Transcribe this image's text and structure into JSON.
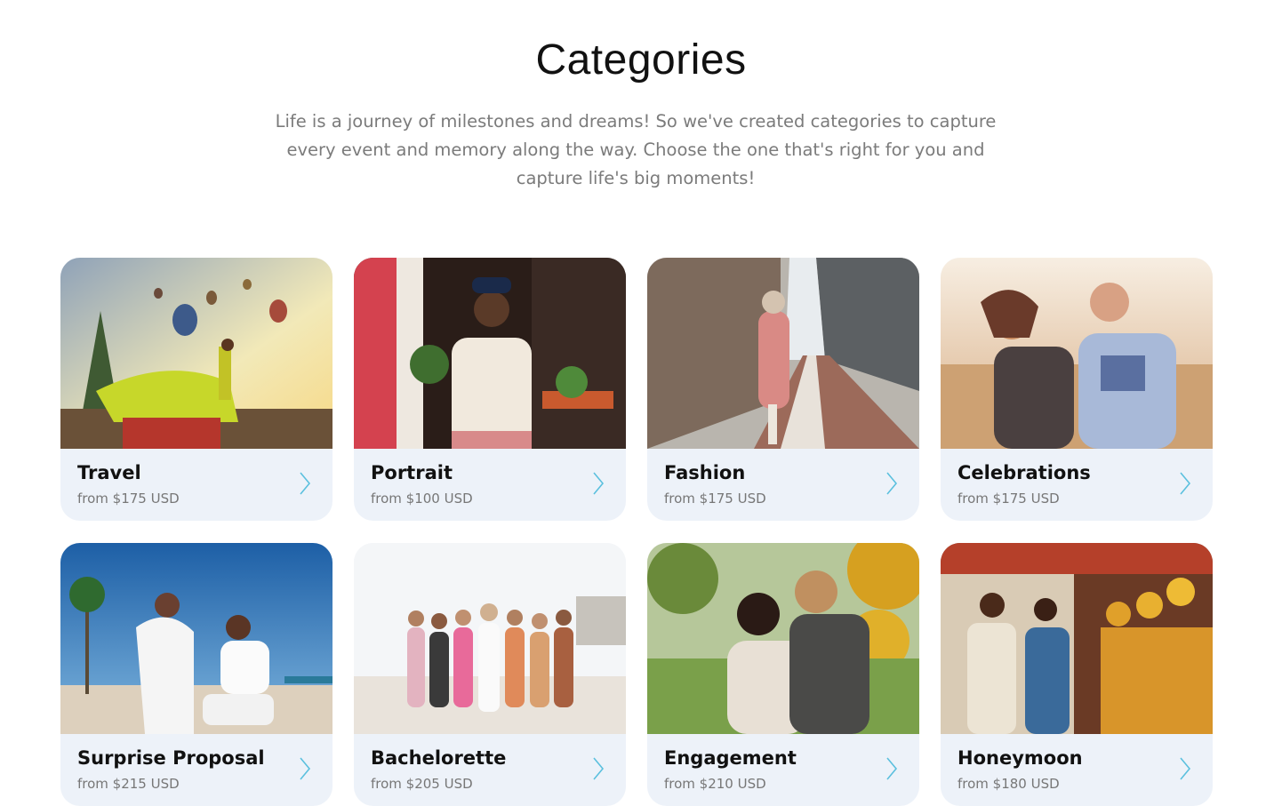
{
  "section": {
    "title": "Categories",
    "intro": "Life is a journey of milestones and dreams! So we've created categories to capture every event and memory along the way. Choose the one that's right for you and capture life's big moments!"
  },
  "colors": {
    "card_background": "#edf2f9",
    "chevron": "#5bc0de",
    "title_text": "#111111",
    "price_text": "#777777"
  },
  "categories": [
    {
      "name": "Travel",
      "price": "from $175 USD",
      "icon": "chevron-right-icon"
    },
    {
      "name": "Portrait",
      "price": "from $100 USD",
      "icon": "chevron-right-icon"
    },
    {
      "name": "Fashion",
      "price": "from $175 USD",
      "icon": "chevron-right-icon"
    },
    {
      "name": "Celebrations",
      "price": "from $175 USD",
      "icon": "chevron-right-icon"
    },
    {
      "name": "Surprise Proposal",
      "price": "from $215 USD",
      "icon": "chevron-right-icon"
    },
    {
      "name": "Bachelorette",
      "price": "from $205 USD",
      "icon": "chevron-right-icon"
    },
    {
      "name": "Engagement",
      "price": "from $210 USD",
      "icon": "chevron-right-icon"
    },
    {
      "name": "Honeymoon",
      "price": "from $180 USD",
      "icon": "chevron-right-icon"
    }
  ]
}
